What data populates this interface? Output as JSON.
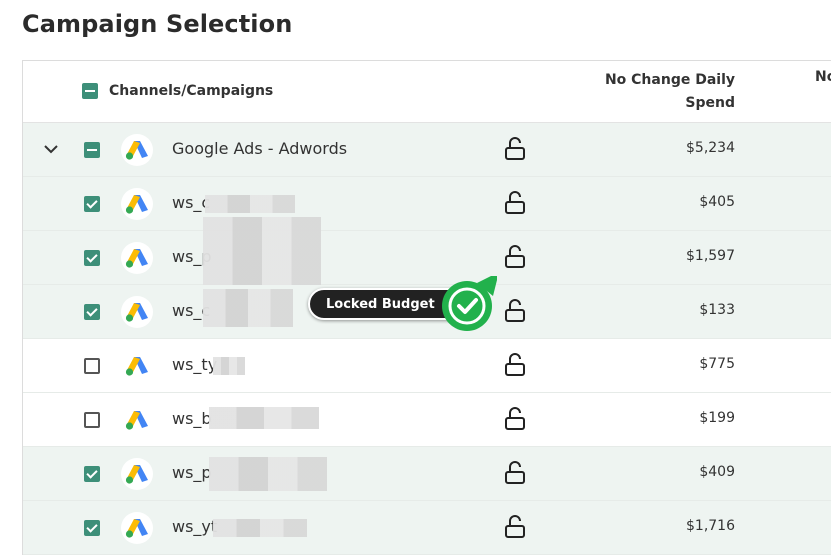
{
  "page": {
    "title": "Campaign Selection"
  },
  "columns": {
    "channels": "Channels/Campaigns",
    "spend_line1": "No Change Daily",
    "spend_line2": "Spend",
    "next_partial": "No"
  },
  "rows": [
    {
      "name": "Google Ads - Adwords",
      "spend": "$5,234",
      "checkbox": "indeterminate",
      "expandable": true,
      "shaded": true
    },
    {
      "name": "ws_c",
      "spend": "$405",
      "checkbox": "checked",
      "shaded": true
    },
    {
      "name": "ws_p",
      "spend": "$1,597",
      "checkbox": "checked",
      "shaded": true
    },
    {
      "name": "ws_c",
      "spend": "$133",
      "checkbox": "checked",
      "shaded": true
    },
    {
      "name": "ws_ty",
      "spend": "$775",
      "checkbox": "unchecked",
      "shaded": false
    },
    {
      "name": "ws_b",
      "spend": "$199",
      "checkbox": "unchecked",
      "shaded": false
    },
    {
      "name": "ws_p",
      "spend": "$409",
      "checkbox": "checked",
      "shaded": true
    },
    {
      "name": "ws_yt",
      "spend": "$1,716",
      "checkbox": "checked",
      "shaded": true
    }
  ],
  "tooltip": {
    "label": "Locked Budget"
  },
  "icons": {
    "lock": "unlocked-padlock-icon",
    "logo": "google-ads-logo-icon",
    "expand": "chevron-down-icon",
    "badge": "check-circle-icon"
  },
  "colors": {
    "checkbox": "#3d8f79",
    "shaded_row": "#eef4f1",
    "badge_green": "#22b14c",
    "tooltip_bg": "#222222"
  }
}
